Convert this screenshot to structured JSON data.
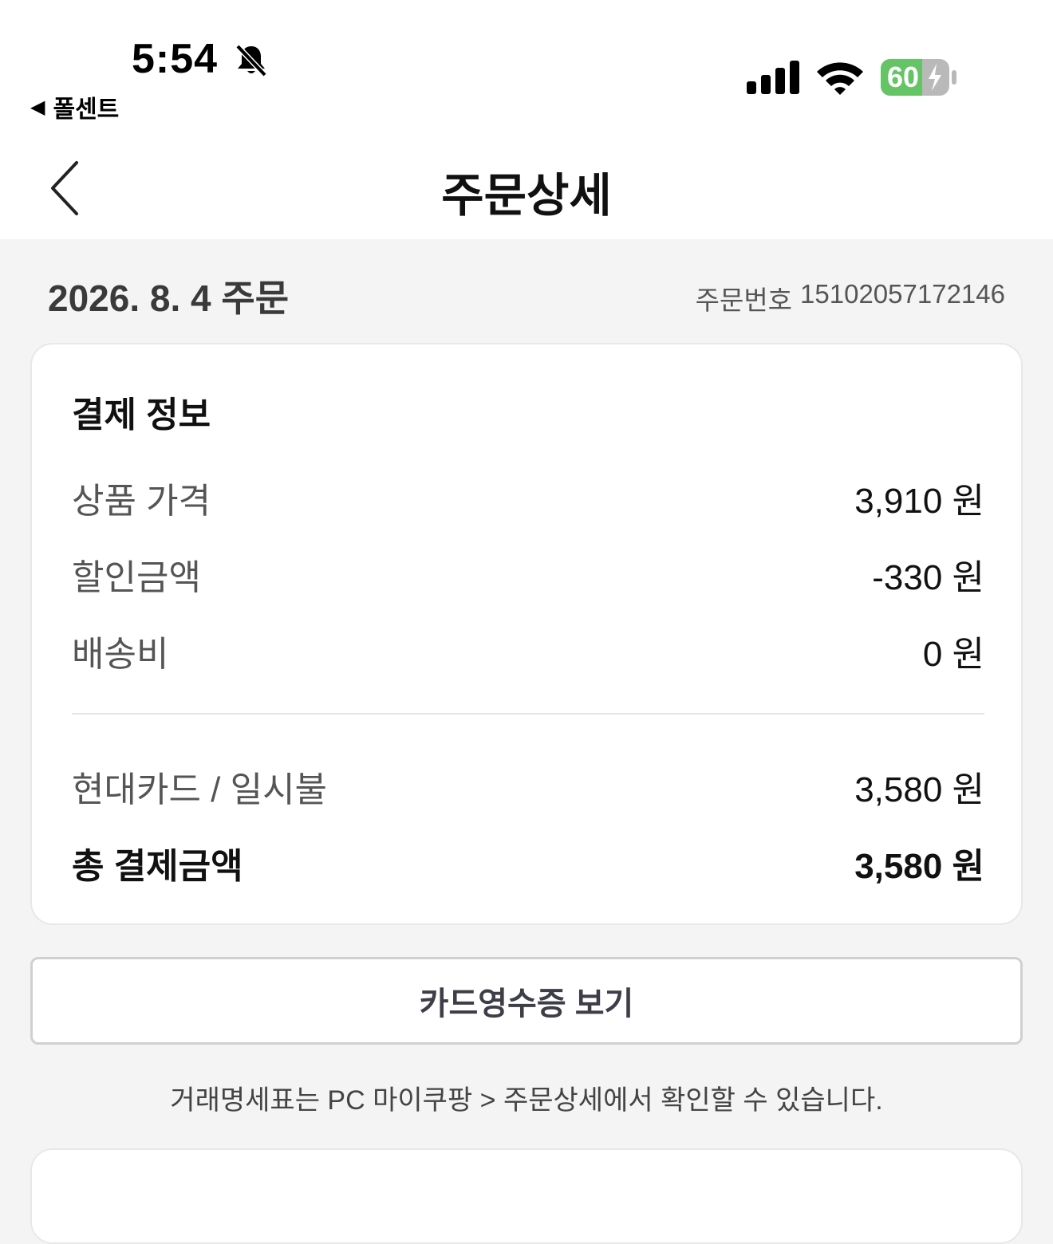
{
  "status_bar": {
    "time": "5:54",
    "back_app_label": "폴센트",
    "battery": "60",
    "icons": [
      "bell-slash-icon",
      "signal-icon",
      "wifi-icon",
      "battery-charging-icon"
    ]
  },
  "nav": {
    "title": "주문상세",
    "back_icon": "chevron-left-icon"
  },
  "order": {
    "date": "2026. 8. 4 주문",
    "number_label": "주문번호",
    "number": "15102057172146"
  },
  "payment": {
    "title": "결제 정보",
    "rows": [
      {
        "label": "상품 가격",
        "value": "3,910 원"
      },
      {
        "label": "할인금액",
        "value": "-330 원"
      },
      {
        "label": "배송비",
        "value": "0 원"
      }
    ],
    "method": {
      "label": "현대카드 / 일시불",
      "value": "3,580 원"
    },
    "total": {
      "label": "총 결제금액",
      "value": "3,580 원"
    }
  },
  "receipt_button": "카드영수증 보기",
  "notice": "거래명세표는 PC 마이쿠팡 > 주문상세에서 확인할 수 있습니다.",
  "colors": {
    "background": "#f4f4f4",
    "card": "#ffffff",
    "battery_green": "#65c466",
    "button_text": "#3e3e48"
  }
}
